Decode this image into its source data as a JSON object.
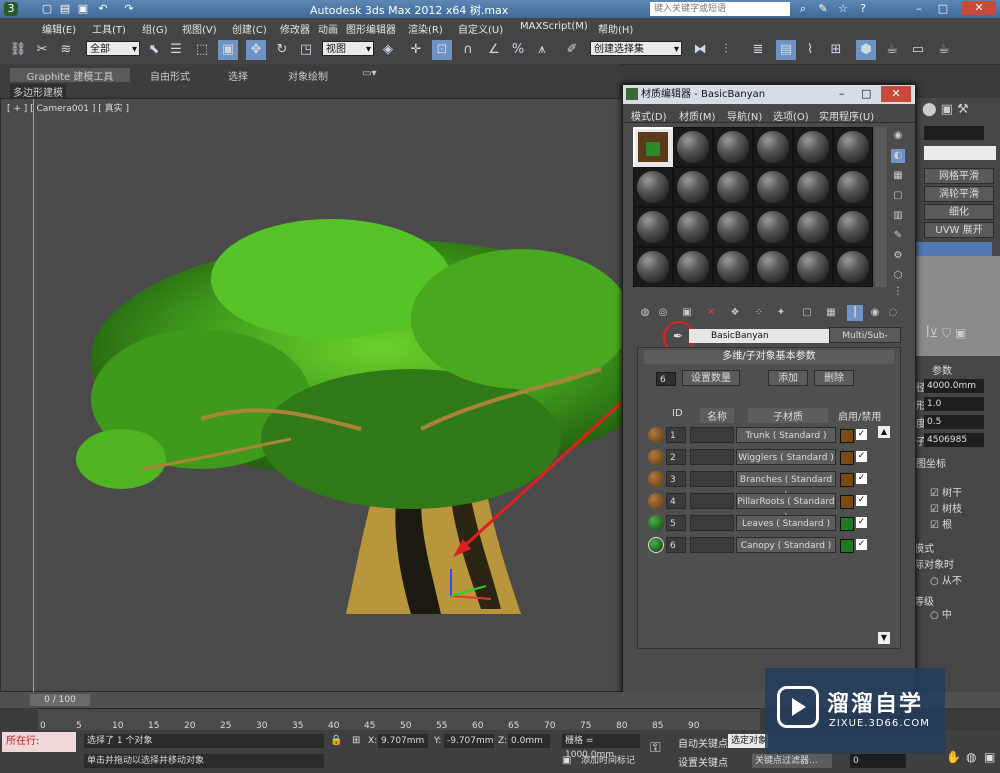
{
  "window": {
    "title": "Autodesk 3ds Max  2012 x64      树.max",
    "search_placeholder": "键入关键字或短语"
  },
  "menu": [
    "编辑(E)",
    "工具(T)",
    "组(G)",
    "视图(V)",
    "创建(C)",
    "修改器",
    "动画",
    "图形编辑器",
    "渲染(R)",
    "自定义(U)",
    "MAXScript(M)",
    "帮助(H)"
  ],
  "toolbar": {
    "selection_filter": "全部",
    "reference_coord": "视图",
    "named_selection": "创建选择集"
  },
  "ribbon": {
    "tabs": [
      "Graphite 建模工具",
      "自由形式",
      "选择",
      "对象绘制"
    ],
    "sub_label": "多边形建模"
  },
  "viewport": {
    "label": "[ + ] [ Camera001 ] [ 真实 ]"
  },
  "command_panel": {
    "buttons": [
      "网格平滑",
      "涡轮平滑",
      "细化",
      "UVW 展开"
    ],
    "params_title": "参数",
    "fields": [
      {
        "label": "径:",
        "value": "4000.0mm"
      },
      {
        "label": "形:",
        "value": "1.0"
      },
      {
        "label": "度:",
        "value": "0.5"
      },
      {
        "label": "子:",
        "value": "4506985"
      }
    ],
    "section1": "图坐标",
    "checks": [
      "树干",
      "树枝",
      "根"
    ],
    "section2": "模式",
    "section2b": "际对象时",
    "radio1": "从不",
    "section3": "等级",
    "radio2": "中"
  },
  "material_editor": {
    "title": "材质编辑器 - BasicBanyan",
    "menu": [
      "模式(D)",
      "材质(M)",
      "导航(N)",
      "选项(O)",
      "实用程序(U)"
    ],
    "material_name": "BasicBanyan",
    "material_type": "Multi/Sub-Object",
    "rollout_title": "多维/子对象基本参数",
    "count": "6",
    "set_count_label": "设置数量",
    "add_label": "添加",
    "delete_label": "删除",
    "headers": {
      "id": "ID",
      "name": "名称",
      "sub": "子材质",
      "enable": "启用/禁用"
    },
    "rows": [
      {
        "id": "1",
        "sub": "Trunk  ( Standard )",
        "color": "#7a4a12"
      },
      {
        "id": "2",
        "sub": "Wigglers  ( Standard )",
        "color": "#7a4a12"
      },
      {
        "id": "3",
        "sub": "Branches  ( Standard )",
        "color": "#7a4a12"
      },
      {
        "id": "4",
        "sub": "PillarRoots  ( Standard )",
        "color": "#7a4a12"
      },
      {
        "id": "5",
        "sub": "Leaves  ( Standard )",
        "color": "#1f7a1f"
      },
      {
        "id": "6",
        "sub": "Canopy  ( Standard )",
        "color": "#1f7a1f"
      }
    ]
  },
  "timeline": {
    "frame": "0 / 100",
    "ticks": [
      "0",
      "5",
      "10",
      "15",
      "20",
      "25",
      "30",
      "35",
      "40",
      "45",
      "50",
      "55",
      "60",
      "65",
      "70",
      "75",
      "80",
      "85",
      "90"
    ]
  },
  "status": {
    "line1": "选择了 1 个对象",
    "line2": "单击并拖动以选择并移动对象",
    "location_label": "所在行:",
    "x": "9.707mm",
    "y": "-9.707mm",
    "z": "0.0mm",
    "grid": "栅格 = 1000.0mm",
    "auto_key": "自动关键点",
    "set_key": "设置关键点",
    "selected": "选定对象",
    "key_filters": "关键点过滤器...",
    "add_time_tag": "添加时间标记",
    "frame_value": "0"
  },
  "watermark": {
    "brand": "溜溜自学",
    "url": "ZIXUE.3D66.COM"
  }
}
